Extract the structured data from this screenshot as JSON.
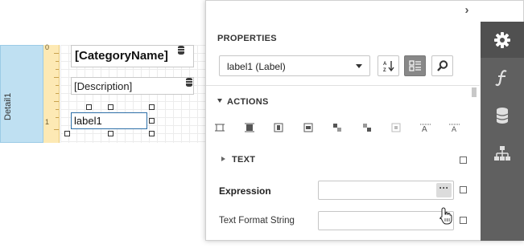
{
  "designer": {
    "band_name": "Detail1",
    "ruler_marks": [
      "0",
      "1"
    ],
    "fields": {
      "category": "[CategoryName]",
      "description": "[Description]",
      "selected_label": "label1"
    }
  },
  "panel": {
    "collapse_icon": "chevron-right-icon",
    "properties_title": "PROPERTIES",
    "component_select": "label1 (Label)",
    "actions_title": "ACTIONS",
    "text_section_title": "TEXT",
    "properties": [
      {
        "label": "Expression",
        "value": "",
        "button": "···",
        "bold": true
      },
      {
        "label": "Text Format String",
        "value": "",
        "button": "···",
        "bold": false
      }
    ]
  },
  "tabs": [
    {
      "name": "properties",
      "icon": "gear-icon",
      "active": true
    },
    {
      "name": "expressions",
      "icon": "function-icon",
      "active": false
    },
    {
      "name": "field-list",
      "icon": "database-icon",
      "active": false
    },
    {
      "name": "report-explorer",
      "icon": "hierarchy-icon",
      "active": false
    }
  ],
  "colors": {
    "band": "#bfe0f2",
    "ruler": "#fde9b4",
    "selection": "#2d6fa8",
    "tabbar": "#606060"
  }
}
